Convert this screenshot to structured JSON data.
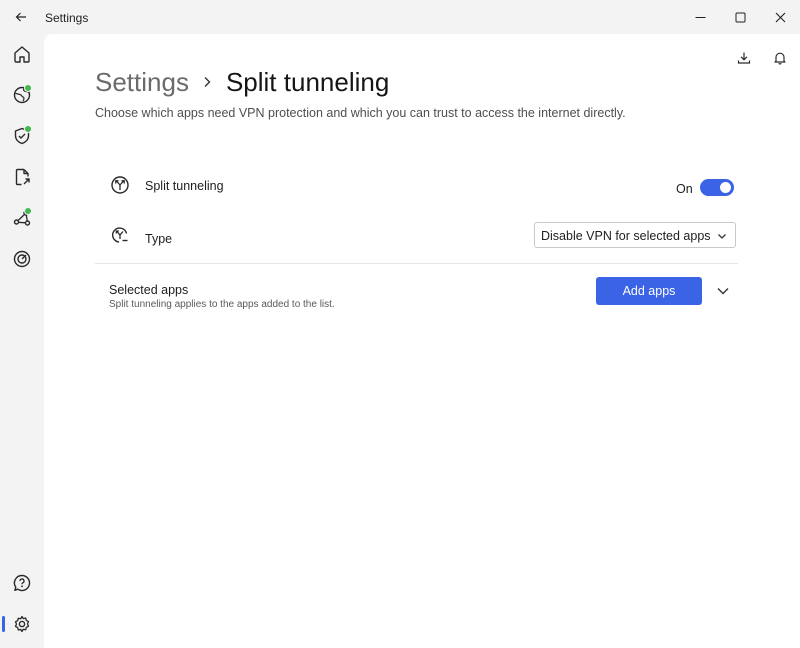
{
  "window": {
    "title": "Settings",
    "back_icon": "arrow-left-icon",
    "minimize_icon": "minimize-icon",
    "maximize_icon": "maximize-icon",
    "close_icon": "close-icon"
  },
  "nav": {
    "items": [
      {
        "id": "home",
        "icon": "home-icon",
        "badge": false
      },
      {
        "id": "vpn",
        "icon": "globe-icon",
        "badge": true
      },
      {
        "id": "protection",
        "icon": "shield-check-icon",
        "badge": true
      },
      {
        "id": "file-sharing",
        "icon": "file-share-icon",
        "badge": false
      },
      {
        "id": "meshnet",
        "icon": "mesh-network-icon",
        "badge": true
      },
      {
        "id": "dark-web-monitor",
        "icon": "target-icon",
        "badge": false
      },
      {
        "id": "help",
        "icon": "help-chat-icon",
        "badge": false
      },
      {
        "id": "settings",
        "icon": "gear-icon",
        "badge": false,
        "active": true
      }
    ],
    "badge_color": "#3fb950",
    "active_color": "#3a63e6"
  },
  "toolbar": {
    "download_icon": "download-icon",
    "notifications_icon": "bell-icon"
  },
  "breadcrumb": {
    "parent": "Settings",
    "separator_icon": "chevron-right-icon",
    "current": "Split tunneling"
  },
  "description": "Choose which apps need VPN protection and which you can trust to access the internet directly.",
  "split_tunneling": {
    "icon": "split-arrows-icon",
    "label": "Split tunneling",
    "state_text": "On",
    "enabled": true
  },
  "type": {
    "icon": "split-type-icon",
    "label": "Type",
    "selected": "Disable VPN for selected apps"
  },
  "selected_apps": {
    "title": "Selected apps",
    "subtitle": "Split tunneling applies to the apps added to the list.",
    "add_button": "Add apps",
    "expand_icon": "chevron-down-icon"
  },
  "colors": {
    "accent": "#3a63e6",
    "background": "#f3f3f3",
    "surface": "#ffffff"
  }
}
